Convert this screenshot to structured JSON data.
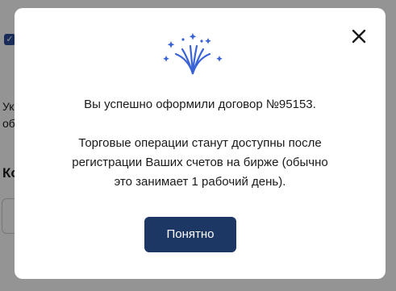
{
  "background": {
    "checkbox_icon": "checkmark-icon",
    "text_line_1": "Ук",
    "text_line_2": "об",
    "heading": "Ко"
  },
  "modal": {
    "close_icon": "close-icon",
    "illustration_icon": "fireworks-icon",
    "message_line_1": "Вы успешно оформили договор №95153.",
    "message_lines": [
      "Торговые операции станут доступны после",
      "регистрации Ваших счетов на бирже (обычно",
      "это занимает 1 рабочий день)."
    ],
    "ok_button_label": "Понятно"
  },
  "colors": {
    "button_bg": "#1d3765",
    "accent_blue": "#3a63d8",
    "overlay": "rgba(0,0,0,0.42)"
  }
}
